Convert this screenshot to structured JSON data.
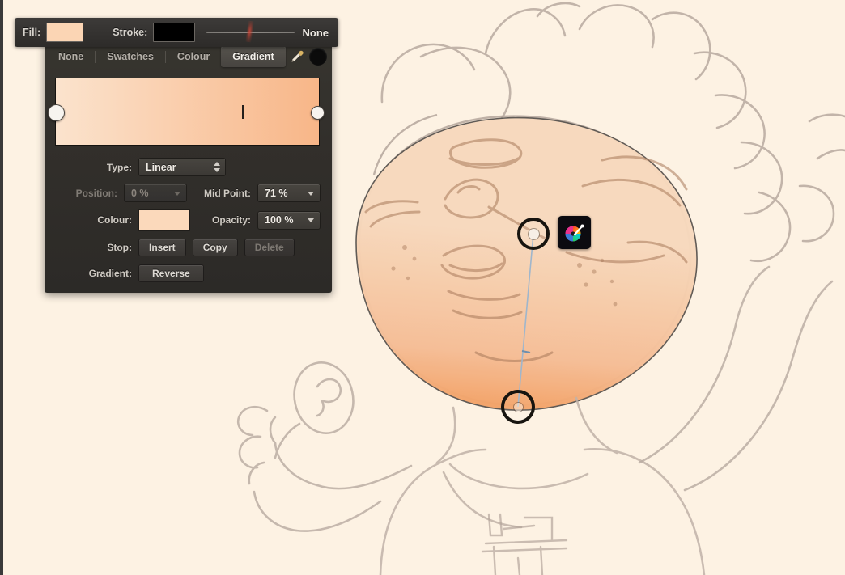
{
  "app": {
    "canvas_background": "#fdf2e3",
    "panel_background": "#332f2b"
  },
  "topbar": {
    "fill_label": "Fill:",
    "fill_color": "#fbd5b4",
    "stroke_label": "Stroke:",
    "stroke_color": "#000000",
    "stroke_width_value": "None",
    "slider_icon": "stroke-width-slider"
  },
  "panel": {
    "tabs": [
      {
        "label": "None",
        "selected": false
      },
      {
        "label": "Swatches",
        "selected": false
      },
      {
        "label": "Colour",
        "selected": false
      },
      {
        "label": "Gradient",
        "selected": true
      }
    ],
    "tab_icons": [
      {
        "name": "eyedropper-icon"
      },
      {
        "name": "current-colour-dot"
      }
    ],
    "gradient_preview": {
      "start_color": "#fbe3cd",
      "end_color": "#f8b688",
      "start_stop_position": "0 %",
      "end_stop_position": "100 %",
      "mid_point_position": "71 %"
    },
    "controls": {
      "type_label": "Type:",
      "type_value": "Linear",
      "position_label": "Position:",
      "position_value": "0 %",
      "position_disabled": true,
      "midpoint_label": "Mid Point:",
      "midpoint_value": "71 %",
      "colour_label": "Colour:",
      "colour_value": "#fbd9bb",
      "opacity_label": "Opacity:",
      "opacity_value": "100 %",
      "stop_label": "Stop:",
      "stop_insert": "Insert",
      "stop_copy": "Copy",
      "stop_delete": "Delete",
      "stop_delete_disabled": true,
      "gradient_label": "Gradient:",
      "gradient_reverse": "Reverse"
    }
  },
  "canvas": {
    "artwork_description": "pencil-sketch cartoon character holding a microphone with a peach gradient-filled face shape",
    "fill_start": "#f7d9bd",
    "fill_end": "#f3a369",
    "handles": {
      "start_handle": "gradient-start-handle",
      "end_handle": "gradient-end-handle",
      "midpoint_marker": "gradient-midpoint-marker"
    },
    "palette_button": "colour-wheel-button"
  }
}
